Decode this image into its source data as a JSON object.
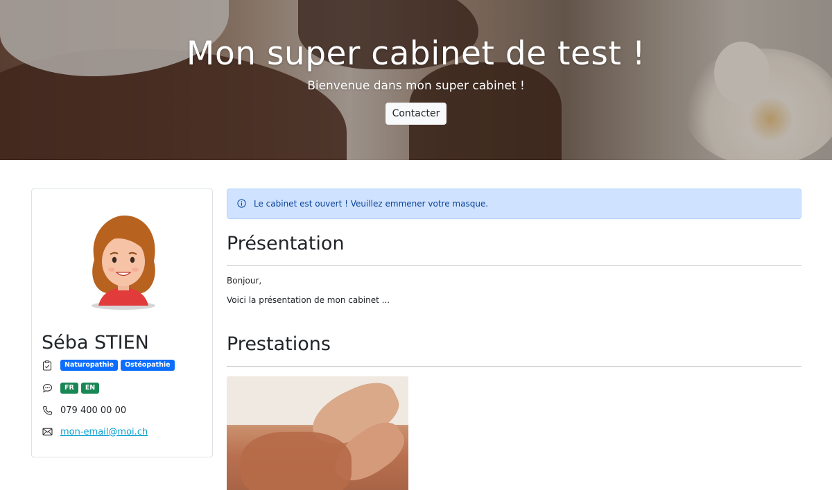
{
  "hero": {
    "title": "Mon super cabinet de test !",
    "subtitle": "Bienvenue dans mon super cabinet !",
    "contact_label": "Contacter"
  },
  "profile": {
    "name": "Séba STIEN",
    "specialties": [
      "Naturopathie",
      "Ostéopathie"
    ],
    "languages": [
      "FR",
      "EN"
    ],
    "phone": "079 400 00 00",
    "email": "mon-email@moi.ch",
    "icons": [
      "clipboard-check-icon",
      "chat-bubble-icon",
      "phone-icon",
      "envelope-icon"
    ]
  },
  "alert": {
    "text": "Le cabinet est ouvert ! Veuillez emmener votre masque.",
    "icon": "info-circle-icon"
  },
  "presentation": {
    "title": "Présentation",
    "lines": [
      "Bonjour,",
      "Voici la présentation de mon cabinet ..."
    ]
  },
  "prestations": {
    "title": "Prestations"
  },
  "colors": {
    "badge_blue": "#0d6efd",
    "badge_green": "#198754",
    "alert_bg": "#cfe2ff",
    "alert_text": "#084298",
    "link": "#0aa0d0"
  }
}
